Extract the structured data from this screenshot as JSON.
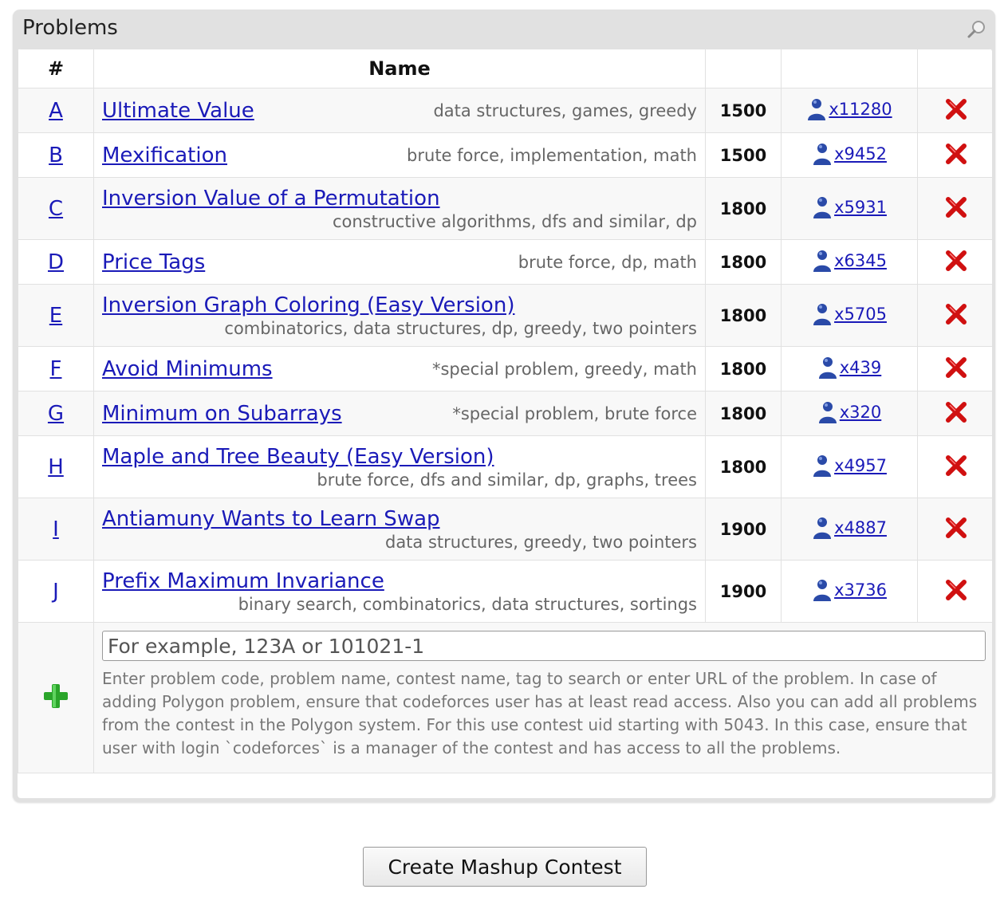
{
  "panel": {
    "title": "Problems",
    "search_icon": "magnifier-icon"
  },
  "table": {
    "headers": {
      "index": "#",
      "name": "Name",
      "rating": "",
      "solved": "",
      "delete": ""
    },
    "rows": [
      {
        "index": "A",
        "name": "Ultimate Value",
        "tags": "data structures, games, greedy",
        "rating": "1500",
        "solved": "x11280",
        "layout": "inline"
      },
      {
        "index": "B",
        "name": "Mexification",
        "tags": "brute force, implementation, math",
        "rating": "1500",
        "solved": "x9452",
        "layout": "inline"
      },
      {
        "index": "C",
        "name": "Inversion Value of a Permutation",
        "tags": "constructive algorithms, dfs and similar, dp",
        "rating": "1800",
        "solved": "x5931",
        "layout": "stacked"
      },
      {
        "index": "D",
        "name": "Price Tags",
        "tags": "brute force, dp, math",
        "rating": "1800",
        "solved": "x6345",
        "layout": "inline"
      },
      {
        "index": "E",
        "name": "Inversion Graph Coloring (Easy Version)",
        "tags": "combinatorics, data structures, dp, greedy, two pointers",
        "rating": "1800",
        "solved": "x5705",
        "layout": "stacked"
      },
      {
        "index": "F",
        "name": "Avoid Minimums",
        "tags": "*special problem, greedy, math",
        "rating": "1800",
        "solved": "x439",
        "layout": "inline"
      },
      {
        "index": "G",
        "name": "Minimum on Subarrays",
        "tags": "*special problem, brute force",
        "rating": "1800",
        "solved": "x320",
        "layout": "inline"
      },
      {
        "index": "H",
        "name": "Maple and Tree Beauty (Easy Version)",
        "tags": "brute force, dfs and similar, dp, graphs, trees",
        "rating": "1800",
        "solved": "x4957",
        "layout": "stacked"
      },
      {
        "index": "I",
        "name": "Antiamuny Wants to Learn Swap",
        "tags": "data structures, greedy, two pointers",
        "rating": "1900",
        "solved": "x4887",
        "layout": "stacked"
      },
      {
        "index": "J",
        "name": "Prefix Maximum Invariance",
        "tags": "binary search, combinatorics, data structures, sortings",
        "rating": "1900",
        "solved": "x3736",
        "layout": "stacked"
      }
    ]
  },
  "add_problem": {
    "placeholder": "For example, 123A or 101021-1",
    "hint": "Enter problem code, problem name, contest name, tag to search or enter URL of the problem. In case of adding Polygon problem, ensure that codeforces user has at least read access. Also you can add all problems from the contest in the Polygon system. For this use contest uid starting with 5043. In this case, ensure that user with login `codeforces` is a manager of the contest and has access to all the problems."
  },
  "create_button": {
    "label": "Create Mashup Contest"
  },
  "colors": {
    "link": "#1a1ab8",
    "delete": "#d01010",
    "plus": "#2aa52a",
    "user": "#2a4aa8"
  }
}
